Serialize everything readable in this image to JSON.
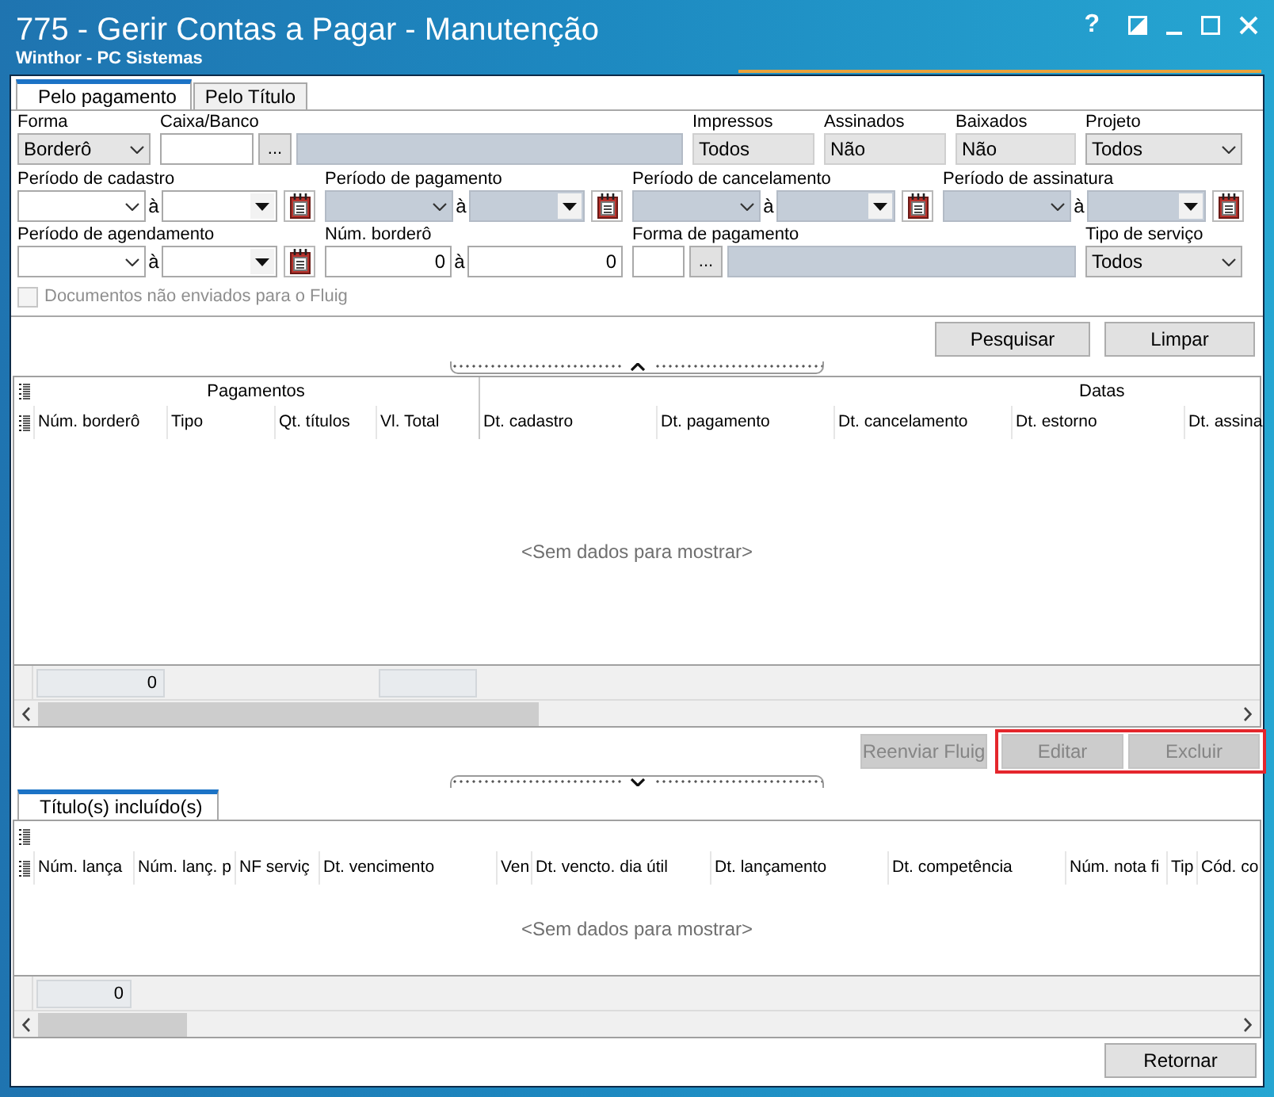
{
  "window": {
    "title": "775 - Gerir Contas a Pagar - Manutenção",
    "subtitle": "Winthor - PC Sistemas",
    "help": "?"
  },
  "tabs": [
    {
      "label": "Pelo pagamento",
      "selected": true
    },
    {
      "label": "Pelo Título",
      "selected": false
    }
  ],
  "filter_rows": [
    [
      {
        "kind": "select",
        "label": "Forma",
        "value": "Borderô"
      },
      {
        "kind": "lookup",
        "label": "Caixa/Banco",
        "button": "..."
      },
      {
        "kind": "readonly",
        "label": "Impressos",
        "value": "Todos"
      },
      {
        "kind": "readonly",
        "label": "Assinados",
        "value": "Não"
      },
      {
        "kind": "readonly",
        "label": "Baixados",
        "value": "Não"
      },
      {
        "kind": "select",
        "label": "Projeto",
        "value": "Todos"
      }
    ],
    [
      {
        "kind": "period",
        "label": "Período de cadastro",
        "separator": "à",
        "disabled": false
      },
      {
        "kind": "period",
        "label": "Período de pagamento",
        "separator": "à",
        "disabled": true
      },
      {
        "kind": "period",
        "label": "Período de cancelamento",
        "separator": "à",
        "disabled": true
      },
      {
        "kind": "period",
        "label": "Período de assinatura",
        "separator": "à",
        "disabled": true
      }
    ],
    [
      {
        "kind": "period",
        "label": "Período de agendamento",
        "separator": "à",
        "disabled": false
      },
      {
        "kind": "range",
        "label": "Núm. borderô",
        "from": "0",
        "separator": "à",
        "to": "0"
      },
      {
        "kind": "lookup",
        "label": "Forma de pagamento",
        "button": "..."
      },
      {
        "kind": "select",
        "label": "Tipo de serviço",
        "value": "Todos"
      }
    ]
  ],
  "documents_checkbox": {
    "label": "Documentos não enviados para o Fluig",
    "checked": false,
    "disabled": true
  },
  "search_buttons": [
    {
      "label": "Pesquisar"
    },
    {
      "label": "Limpar"
    }
  ],
  "payments_grid": {
    "bands": [
      {
        "label": "Pagamentos",
        "columns": [
          {
            "label": "Núm. borderô",
            "summary": true,
            "summary_value": "0"
          },
          {
            "label": "Tipo"
          },
          {
            "label": "Qt. títulos"
          },
          {
            "label": "Vl. Total",
            "summary": true
          }
        ]
      },
      {
        "label": "Datas",
        "columns": [
          {
            "label": "Dt. cadastro"
          },
          {
            "label": "Dt. pagamento"
          },
          {
            "label": "Dt. cancelamento"
          },
          {
            "label": "Dt. estorno"
          },
          {
            "label": "Dt. assina"
          }
        ]
      }
    ],
    "empty_text": "<Sem dados para mostrar>"
  },
  "record_buttons": [
    {
      "label": "Reenviar Fluig",
      "disabled": true,
      "highlighted": false
    },
    {
      "label": "Editar",
      "disabled": true,
      "highlighted": true
    },
    {
      "label": "Excluir",
      "disabled": true,
      "highlighted": true
    }
  ],
  "detail_tabs": [
    {
      "label": "Título(s) incluído(s)",
      "selected": true
    }
  ],
  "titles_grid": {
    "columns": [
      {
        "label": "Núm. lança",
        "summary": true,
        "summary_value": "0"
      },
      {
        "label": "Núm. lanç. p"
      },
      {
        "label": "NF serviç"
      },
      {
        "label": "Dt. vencimento"
      },
      {
        "label": "Ven"
      },
      {
        "label": "Dt. vencto. dia útil"
      },
      {
        "label": "Dt. lançamento"
      },
      {
        "label": "Dt. competência"
      },
      {
        "label": "Núm. nota fi"
      },
      {
        "label": "Tip"
      },
      {
        "label": "Cód. co"
      }
    ],
    "empty_text": "<Sem dados para mostrar>"
  },
  "footer_buttons": [
    {
      "label": "Retornar"
    }
  ]
}
